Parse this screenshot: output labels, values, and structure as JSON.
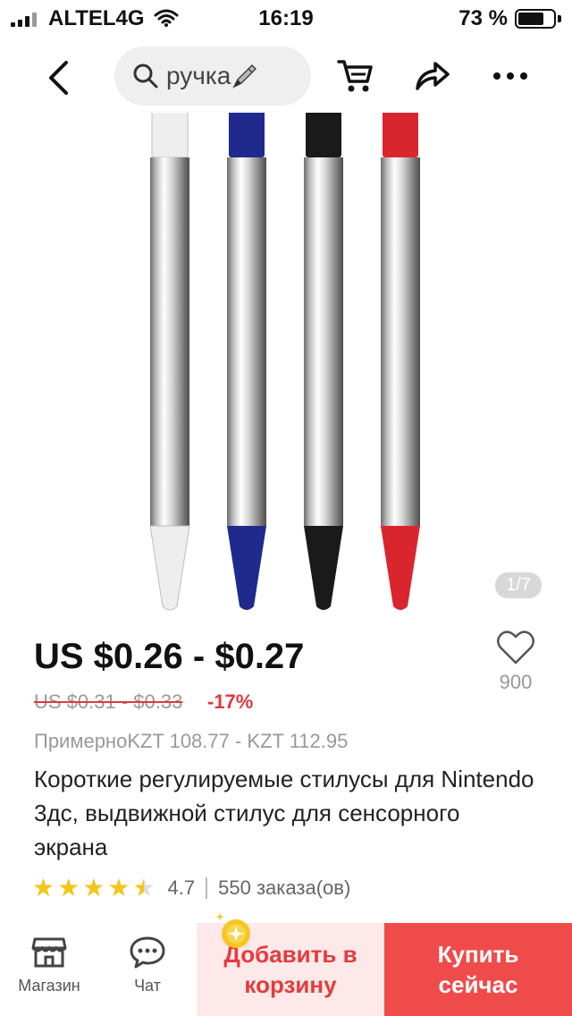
{
  "status_bar": {
    "carrier": "ALTEL4G",
    "time": "16:19",
    "battery_percent": "73 %",
    "battery_level": 0.73
  },
  "nav": {
    "search_query": "ручка",
    "icons": [
      "back-icon",
      "search-icon",
      "pen-icon",
      "cart-icon",
      "share-icon",
      "more-icon"
    ]
  },
  "gallery": {
    "counter": "1/7",
    "stylus_colors": [
      "#eeeeee",
      "#1f2a8c",
      "#1a1a1a",
      "#d9262e"
    ]
  },
  "product": {
    "price": "US $0.26 - $0.27",
    "old_price": "US $0.31 - $0.33",
    "discount": "-17%",
    "approx_price": "ПримерноKZT 108.77 - KZT 112.95",
    "title": "Короткие регулируемые стилусы для Nintendo 3дс, выдвижной стилус для сенсорного экрана",
    "wishlist_count": "900",
    "rating": "4.7",
    "rating_value": 4.7,
    "orders": "550 заказа(ов)"
  },
  "bottom_bar": {
    "store_label": "Магазин",
    "chat_label": "Чат",
    "add_to_cart_label": "Добавить в корзину",
    "buy_now_label": "Купить сейчас"
  },
  "colors": {
    "accent": "#f04b4b",
    "accent_light": "#fde9e9",
    "star": "#f5c518",
    "discount": "#e0393e"
  }
}
